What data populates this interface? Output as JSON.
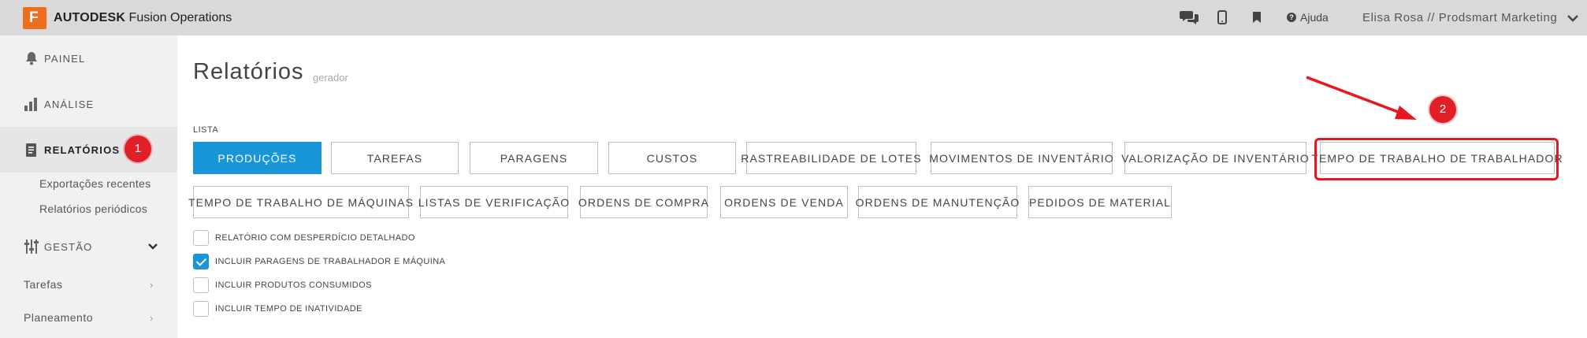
{
  "header": {
    "logo_letter": "F",
    "brand_bold": "AUTODESK",
    "brand_rest": "Fusion Operations",
    "help_label": "Ajuda",
    "user_label": "Elisa Rosa // Prodsmart Marketing"
  },
  "sidebar": {
    "painel": "PAINEL",
    "analise": "ANÁLISE",
    "relatorios": "RELATÓRIOS",
    "sub_items": [
      "Exportações recentes",
      "Relatórios periódicos"
    ],
    "gestao": "GESTÃO",
    "tarefas": "Tarefas",
    "planeamento": "Planeamento"
  },
  "main": {
    "title": "Relatórios",
    "subtitle": "gerador",
    "list_label": "LISTA",
    "tabs_row1": [
      "PRODUÇÕES",
      "TAREFAS",
      "PARAGENS",
      "CUSTOS",
      "RASTREABILIDADE DE LOTES",
      "MOVIMENTOS DE INVENTÁRIO",
      "VALORIZAÇÃO DE INVENTÁRIO",
      "TEMPO DE TRABALHO DE TRABALHADOR"
    ],
    "tabs_row2": [
      "TEMPO DE TRABALHO DE MÁQUINAS",
      "LISTAS DE VERIFICAÇÃO",
      "ORDENS DE COMPRA",
      "ORDENS DE VENDA",
      "ORDENS DE MANUTENÇÃO",
      "PEDIDOS DE MATERIAL"
    ],
    "options": [
      {
        "label": "RELATÓRIO COM DESPERDÍCIO DETALHADO",
        "checked": false
      },
      {
        "label": "INCLUIR PARAGENS DE TRABALHADOR E MÁQUINA",
        "checked": true
      },
      {
        "label": "INCLUIR PRODUTOS CONSUMIDOS",
        "checked": false
      },
      {
        "label": "INCLUIR TEMPO DE INATIVIDADE",
        "checked": false
      }
    ]
  },
  "annotations": {
    "badge_1": "1",
    "badge_2": "2"
  },
  "colors": {
    "accent": "#1896d8",
    "annotation_red": "#e01f26",
    "logo_orange": "#ef6e1d"
  }
}
